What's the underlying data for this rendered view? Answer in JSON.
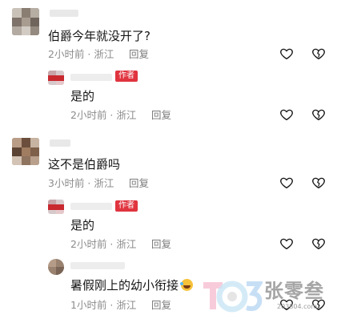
{
  "comments": [
    {
      "text": "伯爵今年就没开了?",
      "time": "2小时前 · 浙江",
      "reply_label": "回复",
      "reply": {
        "badge": "作者",
        "text": "是的",
        "time": "2小时前 · 浙江",
        "reply_label": "回复"
      }
    },
    {
      "text": "这不是伯爵吗",
      "time": "3小时前 · 浙江",
      "reply_label": "回复",
      "replies": [
        {
          "badge": "作者",
          "text": "是的",
          "time": "2小时前 · 浙江",
          "reply_label": "回复"
        },
        {
          "text": "暑假刚上的幼小衔接",
          "time": "1小时前 · 浙江",
          "reply_label": "回复"
        }
      ]
    }
  ],
  "watermark": {
    "brand": "张零叁",
    "url": "203804.com"
  },
  "icons": {
    "like": "heart-outline-icon",
    "dislike": "broken-heart-icon",
    "emoji": "laughing-tears-emoji"
  },
  "colors": {
    "author_badge": "#e0343f",
    "meta_text": "#8c8c8c",
    "text": "#161616"
  }
}
